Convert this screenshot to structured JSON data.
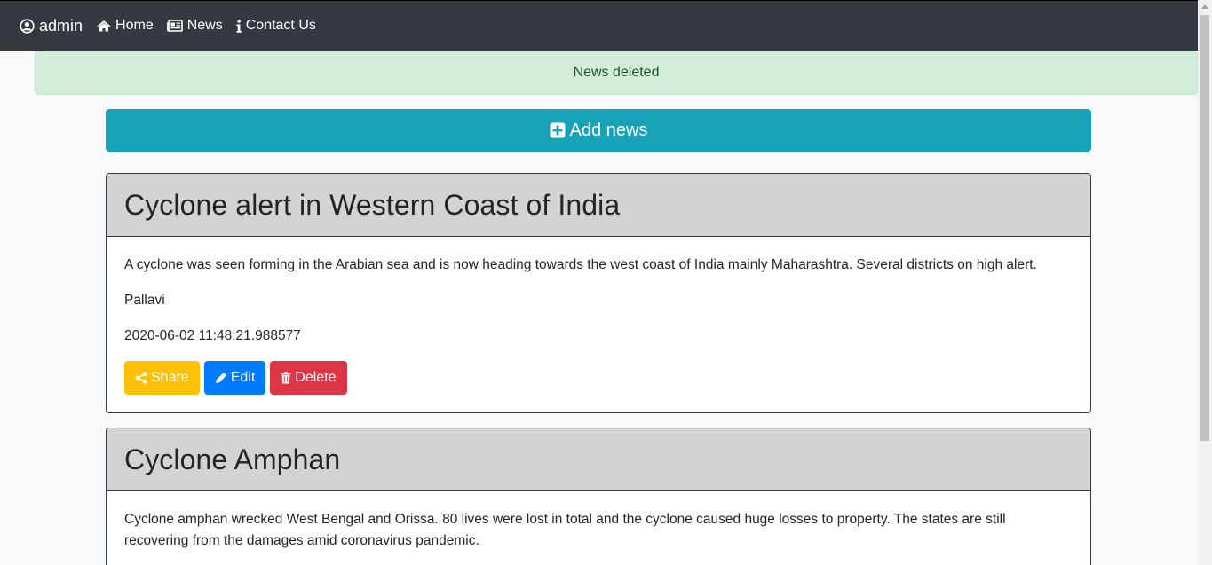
{
  "navbar": {
    "brand_label": "admin",
    "items": [
      {
        "label": "Home",
        "icon": "home-icon"
      },
      {
        "label": "News",
        "icon": "newspaper-icon"
      },
      {
        "label": "Contact Us",
        "icon": "info-icon"
      }
    ],
    "background": "#343a40"
  },
  "alert": {
    "message": "News deleted",
    "background": "#d4edda",
    "text_color": "#155724"
  },
  "add_button": {
    "label": "Add news",
    "icon": "plus-square-icon",
    "background": "#17a2b8"
  },
  "news": [
    {
      "title": "Cyclone alert in Western Coast of India",
      "body": "A cyclone was seen forming in the Arabian sea and is now heading towards the west coast of India mainly Maharashtra. Several districts on high alert.",
      "author": "Pallavi",
      "timestamp": "2020-06-02 11:48:21.988577",
      "share_label": "Share",
      "edit_label": "Edit",
      "delete_label": "Delete"
    },
    {
      "title": "Cyclone Amphan",
      "body": "Cyclone amphan wrecked West Bengal and Orissa. 80 lives were lost in total and the cyclone caused huge losses to property. The states are still recovering from the damages amid coronavirus pandemic."
    }
  ],
  "colors": {
    "share": "#ffc107",
    "edit": "#007bff",
    "delete": "#dc3545",
    "card_header": "#d3d3d3"
  }
}
